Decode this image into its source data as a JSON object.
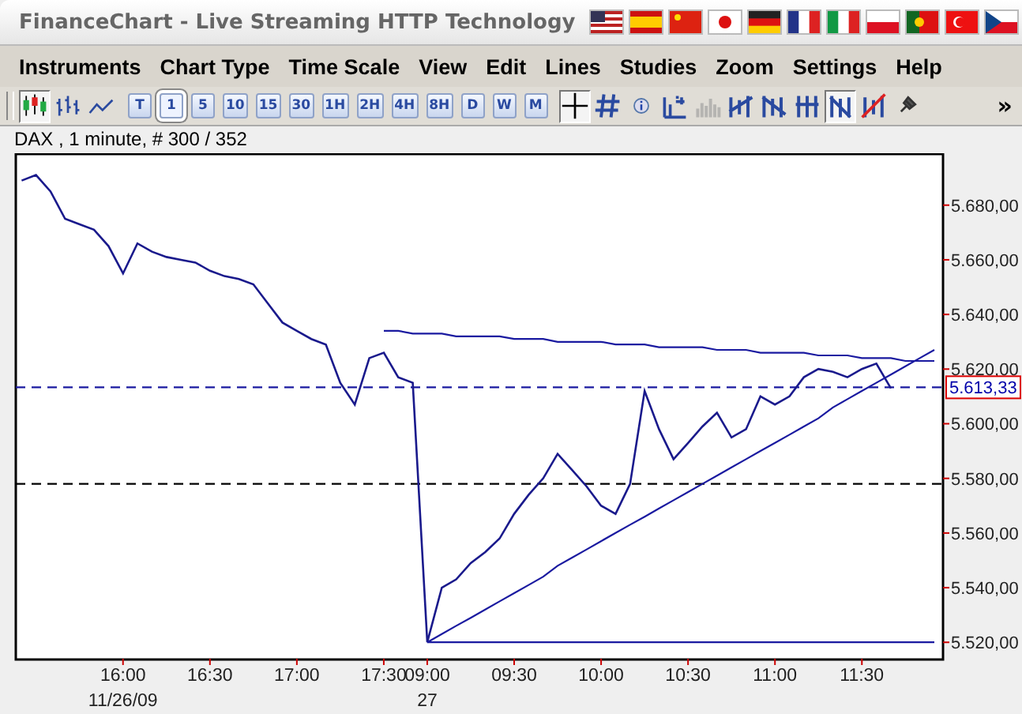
{
  "window": {
    "title": "FinanceChart - Live Streaming HTTP Technology"
  },
  "menu": [
    "Instruments",
    "Chart Type",
    "Time Scale",
    "View",
    "Edit",
    "Lines",
    "Studies",
    "Zoom",
    "Settings",
    "Help"
  ],
  "toolbar": {
    "chart_styles": [
      {
        "selected": true
      },
      {
        "selected": false
      },
      {
        "selected": false
      }
    ],
    "intervals": [
      {
        "label": "T",
        "selected": false
      },
      {
        "label": "1",
        "selected": true
      },
      {
        "label": "5",
        "selected": false
      },
      {
        "label": "10",
        "selected": false
      },
      {
        "label": "15",
        "selected": false
      },
      {
        "label": "30",
        "selected": false
      },
      {
        "label": "1H",
        "selected": false
      },
      {
        "label": "2H",
        "selected": false
      },
      {
        "label": "4H",
        "selected": false
      },
      {
        "label": "8H",
        "selected": false
      },
      {
        "label": "D",
        "selected": false
      },
      {
        "label": "W",
        "selected": false
      },
      {
        "label": "M",
        "selected": false
      }
    ],
    "tools": [
      {
        "selected": true,
        "disabled": false
      },
      {
        "selected": false,
        "disabled": false
      },
      {
        "selected": false,
        "disabled": false
      },
      {
        "selected": false,
        "disabled": false
      },
      {
        "selected": false,
        "disabled": true
      },
      {
        "selected": false,
        "disabled": false
      },
      {
        "selected": false,
        "disabled": false
      },
      {
        "selected": false,
        "disabled": false
      },
      {
        "selected": true,
        "disabled": false
      },
      {
        "selected": false,
        "disabled": false
      },
      {
        "selected": false,
        "disabled": false
      }
    ],
    "more": "»"
  },
  "chart": {
    "title": "DAX , 1 minute, # 300 / 352",
    "date_labels": [
      "11/26/09",
      "27"
    ],
    "chart_data": {
      "type": "line",
      "ylim": [
        5514,
        5699
      ],
      "categories": [
        null,
        null,
        null,
        null,
        null,
        null,
        null,
        "16:00",
        null,
        null,
        null,
        null,
        null,
        "16:30",
        null,
        null,
        null,
        null,
        null,
        "17:00",
        null,
        null,
        null,
        null,
        null,
        "17:30",
        null,
        null,
        "09:00",
        null,
        null,
        null,
        null,
        null,
        "09:30",
        null,
        null,
        null,
        null,
        null,
        "10:00",
        null,
        null,
        null,
        null,
        null,
        "10:30",
        null,
        null,
        null,
        null,
        null,
        "11:00",
        null,
        null,
        null,
        null,
        null,
        "11:30",
        null,
        null,
        null,
        null,
        null
      ],
      "yticks": [
        {
          "value": 5520,
          "label": "5.520,00"
        },
        {
          "value": 5540,
          "label": "5.540,00"
        },
        {
          "value": 5560,
          "label": "5.560,00"
        },
        {
          "value": 5580,
          "label": "5.580,00"
        },
        {
          "value": 5600,
          "label": "5.600,00"
        },
        {
          "value": 5620,
          "label": "5.620,00"
        },
        {
          "value": 5640,
          "label": "5.640,00"
        },
        {
          "value": 5660,
          "label": "5.660,00"
        },
        {
          "value": 5680,
          "label": "5.680,00"
        }
      ],
      "series": [
        {
          "color": "#1a1a8c",
          "values": [
            5689,
            5691,
            5685,
            5675,
            5673,
            5671,
            5665,
            5655,
            5666,
            5663,
            5661,
            5660,
            5659,
            5656,
            5654,
            5653,
            5651,
            5644,
            5637,
            5634,
            5631,
            5629,
            5615,
            5607,
            5624,
            5626,
            5617,
            5615,
            5520,
            5540,
            5543,
            5549,
            5553,
            5558,
            5567,
            5574,
            5580,
            5589,
            5583,
            5577,
            5570,
            5567,
            5578,
            5612,
            5598,
            5587,
            5593,
            5599,
            5604,
            5595,
            5598,
            5610,
            5607,
            5610,
            5617,
            5620,
            5619,
            5617,
            5620,
            5622,
            5613,
            null,
            null,
            null
          ]
        },
        {
          "color": "#1a1aa0",
          "values": [
            null,
            null,
            null,
            null,
            null,
            null,
            null,
            null,
            null,
            null,
            null,
            null,
            null,
            null,
            null,
            null,
            null,
            null,
            null,
            null,
            null,
            null,
            null,
            null,
            null,
            5634,
            5634,
            5633,
            5633,
            5633,
            5632,
            5632,
            5632,
            5632,
            5631,
            5631,
            5631,
            5630,
            5630,
            5630,
            5630,
            5629,
            5629,
            5629,
            5628,
            5628,
            5628,
            5628,
            5627,
            5627,
            5627,
            5626,
            5626,
            5626,
            5626,
            5625,
            5625,
            5625,
            5624,
            5624,
            5624,
            5623,
            5623,
            5623
          ]
        },
        {
          "color": "#1a1aa0",
          "values": [
            null,
            null,
            null,
            null,
            null,
            null,
            null,
            null,
            null,
            null,
            null,
            null,
            null,
            null,
            null,
            null,
            null,
            null,
            null,
            null,
            null,
            null,
            null,
            null,
            null,
            null,
            null,
            null,
            5520,
            5523,
            5526,
            5529,
            5532,
            5535,
            5538,
            5541,
            5544,
            5548,
            5551,
            5554,
            5557,
            5560,
            5563,
            5566,
            5569,
            5572,
            5575,
            5578,
            5581,
            5584,
            5587,
            5590,
            5593,
            5596,
            5599,
            5602,
            5606,
            5609,
            5612,
            5615,
            5618,
            5621,
            5624,
            5627
          ]
        },
        {
          "color": "#1a1aa0",
          "values": [
            null,
            null,
            null,
            null,
            null,
            null,
            null,
            null,
            null,
            null,
            null,
            null,
            null,
            null,
            null,
            null,
            null,
            null,
            null,
            null,
            null,
            null,
            null,
            null,
            null,
            null,
            null,
            null,
            5520,
            5520,
            5520,
            5520,
            5520,
            5520,
            5520,
            5520,
            5520,
            5520,
            5520,
            5520,
            5520,
            5520,
            5520,
            5520,
            5520,
            5520,
            5520,
            5520,
            5520,
            5520,
            5520,
            5520,
            5520,
            5520,
            5520,
            5520,
            5520,
            5520,
            5520,
            5520,
            5520,
            5520,
            5520,
            5520
          ]
        }
      ],
      "ref_lines": [
        {
          "axis": "y",
          "value": 5613.33,
          "label": "5.613,33"
        },
        {
          "axis": "y",
          "value": 5578
        }
      ]
    }
  }
}
